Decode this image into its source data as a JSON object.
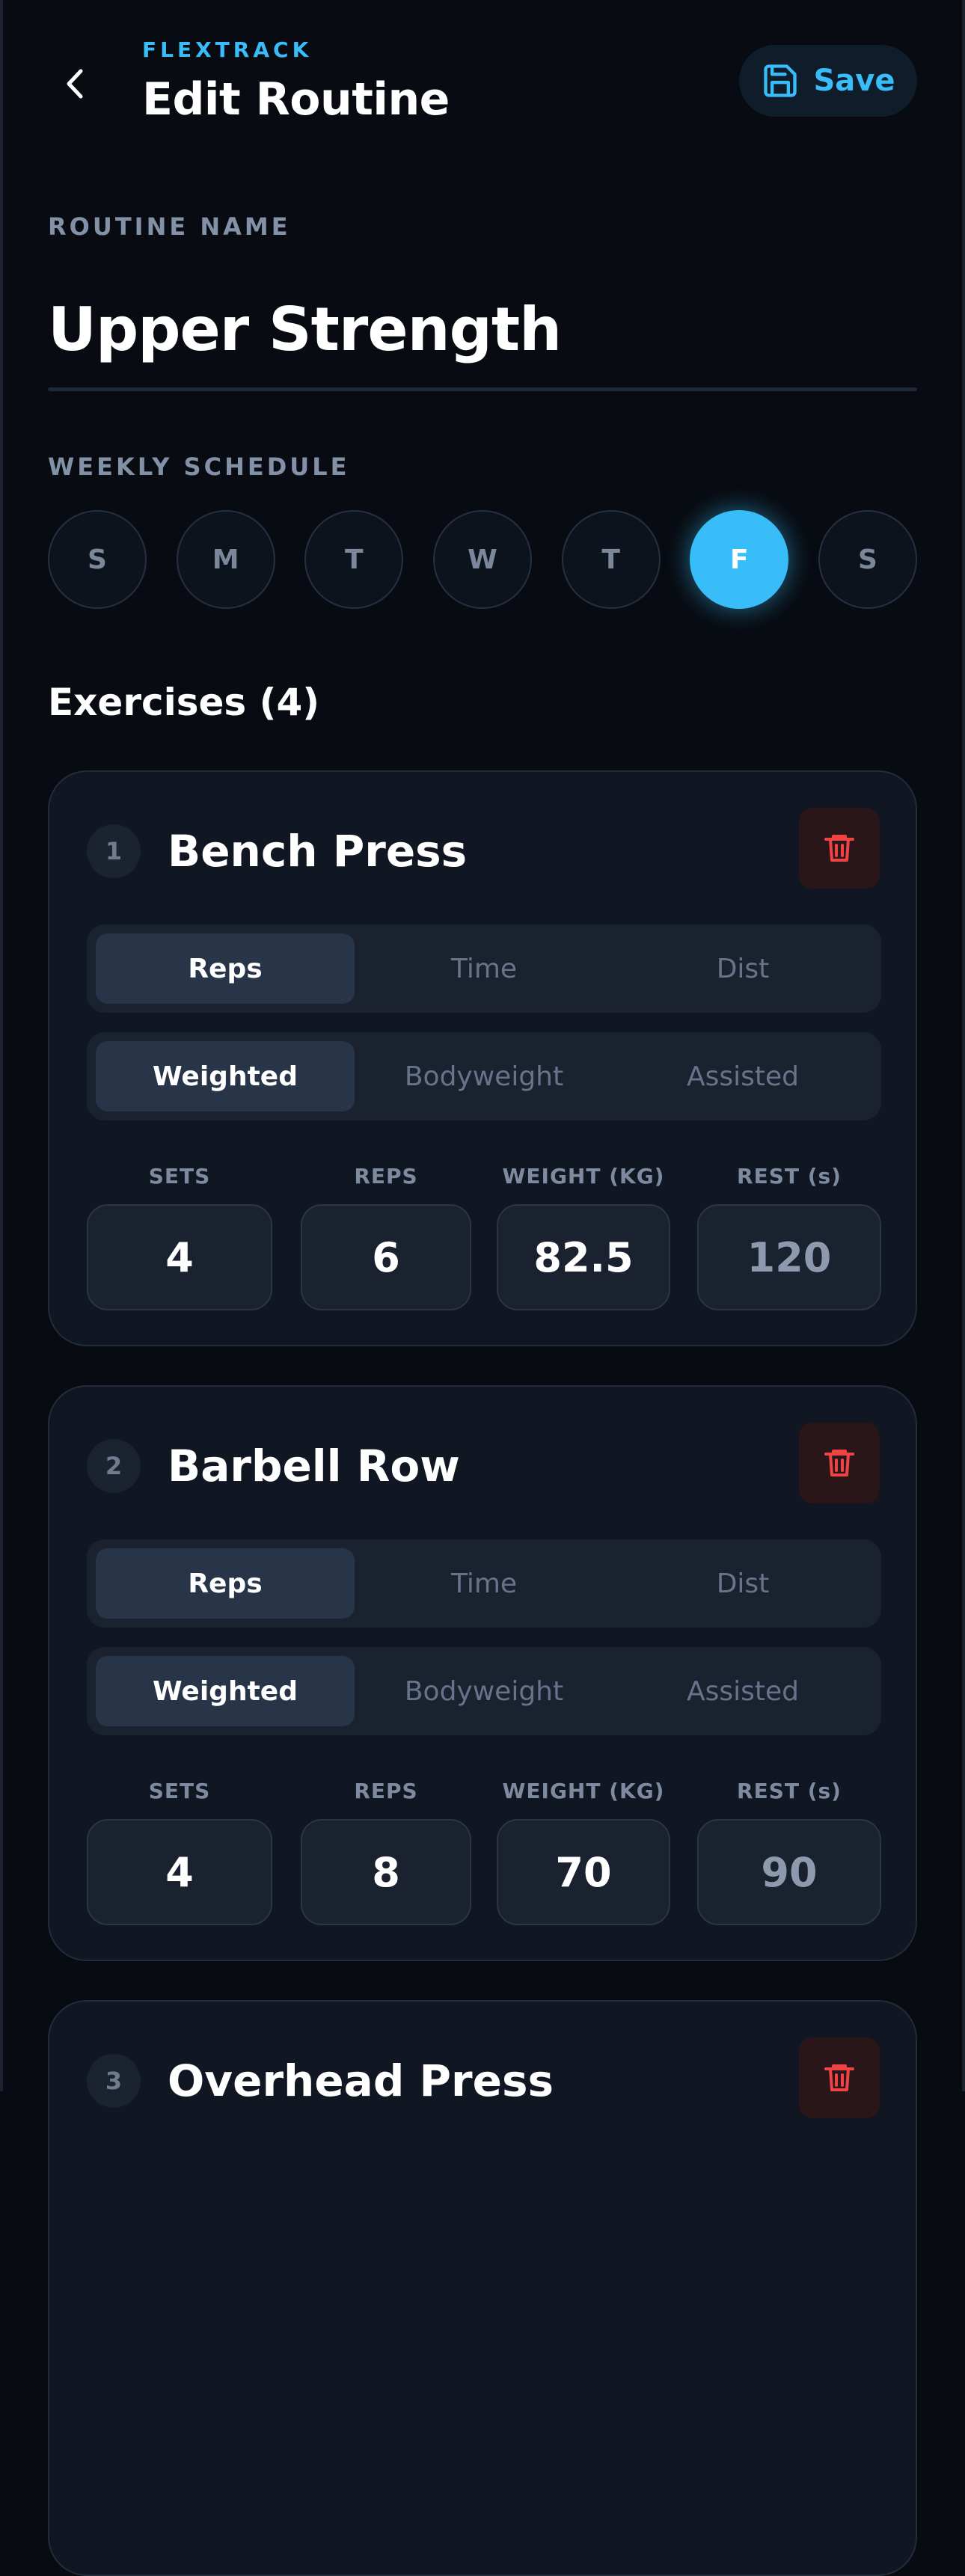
{
  "header": {
    "brand": "FLEXTRACK",
    "title": "Edit Routine",
    "save_label": "Save"
  },
  "routine_name": {
    "label": "ROUTINE NAME",
    "value": "Upper Strength"
  },
  "schedule": {
    "label": "WEEKLY SCHEDULE",
    "days": [
      "S",
      "M",
      "T",
      "W",
      "T",
      "F",
      "S"
    ],
    "active_index": 5
  },
  "exercises_heading": "Exercises (4)",
  "field_labels": {
    "sets": "SETS",
    "reps": "REPS",
    "weight": "WEIGHT (KG)",
    "rest": "REST (s)"
  },
  "tracking_options": [
    "Reps",
    "Time",
    "Dist"
  ],
  "load_options": [
    "Weighted",
    "Bodyweight",
    "Assisted"
  ],
  "exercises": [
    {
      "index": "1",
      "name": "Bench Press",
      "tracking": "Reps",
      "load": "Weighted",
      "sets": "4",
      "reps": "6",
      "weight": "82.5",
      "rest": "120"
    },
    {
      "index": "2",
      "name": "Barbell Row",
      "tracking": "Reps",
      "load": "Weighted",
      "sets": "4",
      "reps": "8",
      "weight": "70",
      "rest": "90"
    },
    {
      "index": "3",
      "name": "Overhead Press"
    }
  ],
  "colors": {
    "background": "#080b11",
    "accent": "#38bdf8",
    "card": "#111722",
    "danger": "#ef4444"
  }
}
